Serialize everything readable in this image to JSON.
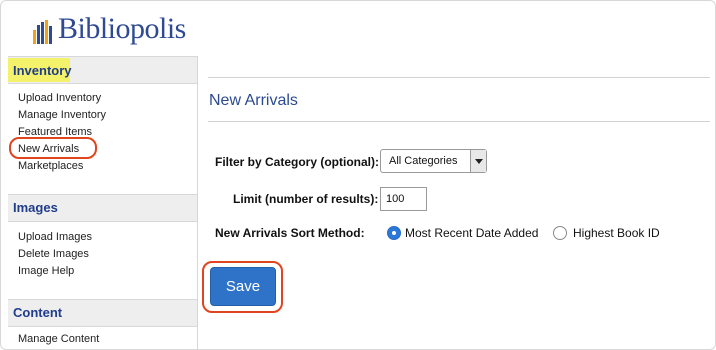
{
  "brand": {
    "name": "Bibliopolis"
  },
  "sidebar": {
    "sections": [
      {
        "title": "Inventory",
        "items": [
          "Upload Inventory",
          "Manage Inventory",
          "Featured Items",
          "New Arrivals",
          "Marketplaces"
        ]
      },
      {
        "title": "Images",
        "items": [
          "Upload Images",
          "Delete Images",
          "Image Help"
        ]
      },
      {
        "title": "Content",
        "items": [
          "Manage Content"
        ]
      }
    ],
    "highlight_color": "#f4f26a",
    "callout_color": "#e0451f"
  },
  "main": {
    "title": "New Arrivals",
    "filter": {
      "label": "Filter by Category (optional):",
      "selected": "All Categories"
    },
    "limit": {
      "label": "Limit (number of results):",
      "value": "100"
    },
    "sort": {
      "label": "New Arrivals Sort Method:",
      "options": [
        {
          "label": "Most Recent Date Added",
          "selected": true
        },
        {
          "label": "Highest Book ID",
          "selected": false
        }
      ]
    },
    "save_label": "Save"
  }
}
